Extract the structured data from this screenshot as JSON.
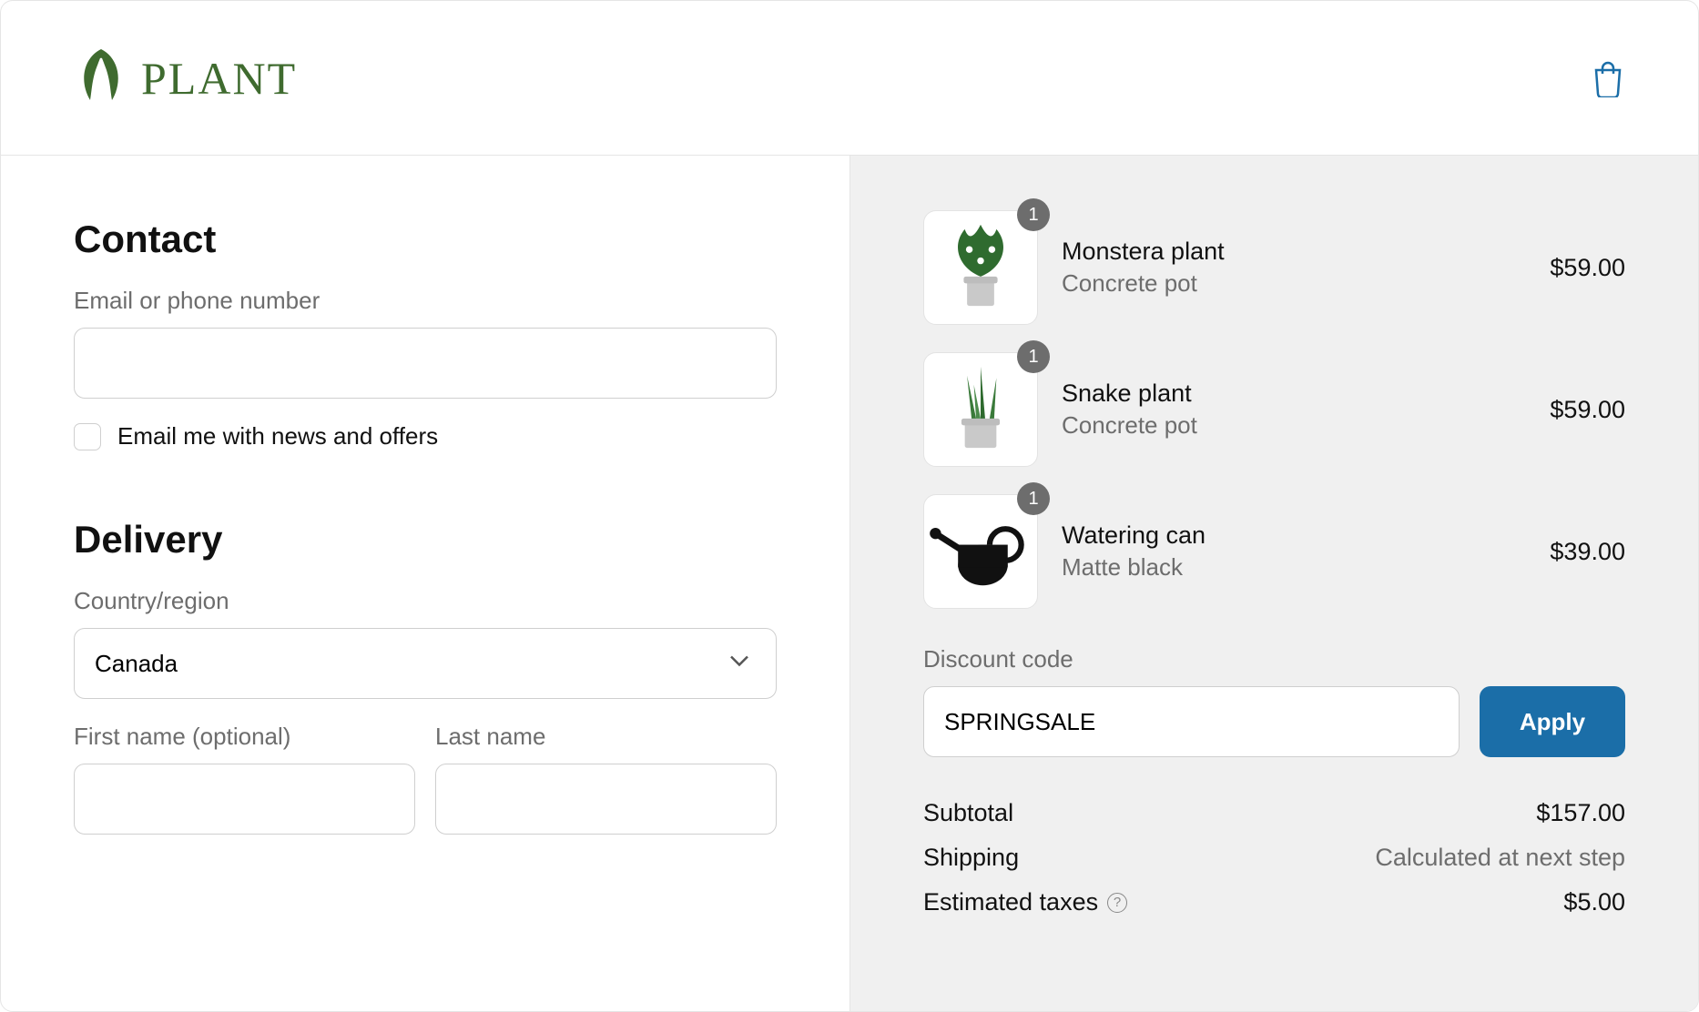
{
  "header": {
    "brand_text": "PLANT",
    "cart_icon": "shopping-bag"
  },
  "contact": {
    "heading": "Contact",
    "email_label": "Email or phone number",
    "email_value": "",
    "news_checkbox_label": "Email me with news and offers",
    "news_checked": false
  },
  "delivery": {
    "heading": "Delivery",
    "country_label": "Country/region",
    "country_value": "Canada",
    "first_name_label": "First name (optional)",
    "first_name_value": "",
    "last_name_label": "Last name",
    "last_name_value": ""
  },
  "cart": {
    "items": [
      {
        "name": "Monstera plant",
        "variant": "Concrete pot",
        "qty": "1",
        "price": "$59.00",
        "icon": "monstera"
      },
      {
        "name": "Snake plant",
        "variant": "Concrete pot",
        "qty": "1",
        "price": "$59.00",
        "icon": "snake"
      },
      {
        "name": "Watering can",
        "variant": "Matte black",
        "qty": "1",
        "price": "$39.00",
        "icon": "wateringcan"
      }
    ]
  },
  "discount": {
    "label": "Discount code",
    "value": "SPRINGSALE",
    "apply_label": "Apply"
  },
  "totals": {
    "subtotal_label": "Subtotal",
    "subtotal_value": "$157.00",
    "shipping_label": "Shipping",
    "shipping_value": "Calculated at next step",
    "taxes_label": "Estimated taxes",
    "taxes_value": "$5.00"
  }
}
